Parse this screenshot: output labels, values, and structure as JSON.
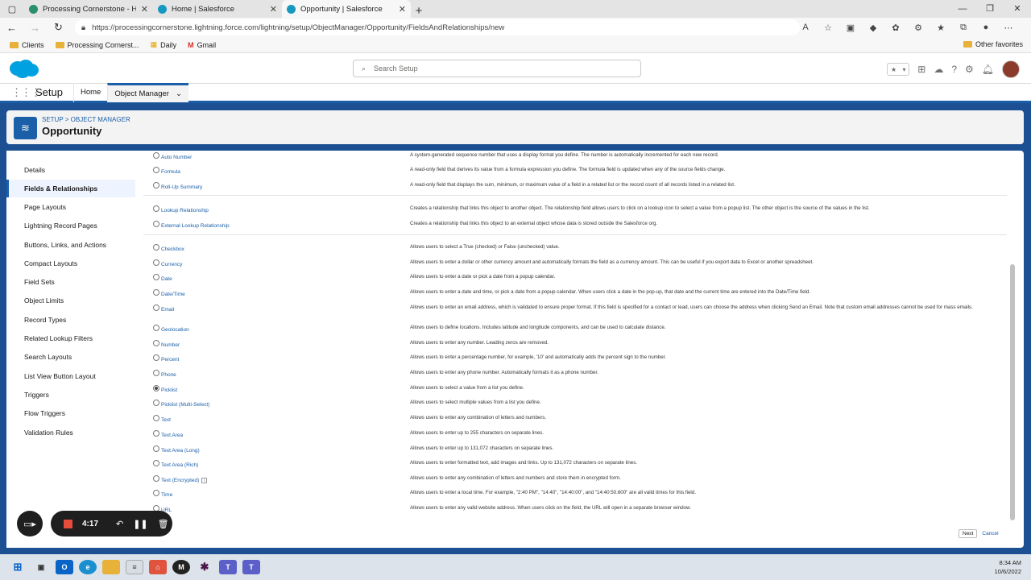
{
  "browser": {
    "tabs": [
      {
        "title": "Processing Cornerstone - Home",
        "favicon_color": "#2a8f6a"
      },
      {
        "title": "Home | Salesforce",
        "favicon_color": "#1798c1"
      },
      {
        "title": "Opportunity | Salesforce",
        "favicon_color": "#1798c1"
      }
    ],
    "url": "https://processingcornerstone.lightning.force.com/lightning/setup/ObjectManager/Opportunity/FieldsAndRelationships/new",
    "bookmarks": [
      "Clients",
      "Processing Cornerst...",
      "Daily",
      "Gmail"
    ],
    "other_favorites": "Other favorites"
  },
  "header": {
    "search_placeholder": "Search Setup"
  },
  "nav": {
    "app_name": "Setup",
    "home": "Home",
    "object_manager": "Object Manager"
  },
  "object": {
    "breadcrumb": "SETUP > OBJECT MANAGER",
    "title": "Opportunity"
  },
  "sidebar": {
    "items": [
      "Details",
      "Fields & Relationships",
      "Page Layouts",
      "Lightning Record Pages",
      "Buttons, Links, and Actions",
      "Compact Layouts",
      "Field Sets",
      "Object Limits",
      "Record Types",
      "Related Lookup Filters",
      "Search Layouts",
      "List View Button Layout",
      "Triggers",
      "Flow Triggers",
      "Validation Rules"
    ],
    "active_index": 1
  },
  "field_types": [
    {
      "label": "Auto Number",
      "desc": "A system-generated sequence number that uses a display format you define. The number is automatically incremented for each new record."
    },
    {
      "label": "Formula",
      "desc": "A read-only field that derives its value from a formula expression you define. The formula field is updated when any of the source fields change."
    },
    {
      "label": "Roll-Up Summary",
      "desc": "A read-only field that displays the sum, minimum, or maximum value of a field in a related list or the record count of all records listed in a related list."
    },
    {
      "label": "Lookup Relationship",
      "desc": "Creates a relationship that links this object to another object. The relationship field allows users to click on a lookup icon to select a value from a popup list. The other object is the source of the values in the list."
    },
    {
      "label": "External Lookup Relationship",
      "desc": "Creates a relationship that links this object to an external object whose data is stored outside the Salesforce org."
    },
    {
      "label": "Checkbox",
      "desc": "Allows users to select a True (checked) or False (unchecked) value."
    },
    {
      "label": "Currency",
      "desc": "Allows users to enter a dollar or other currency amount and automatically formats the field as a currency amount. This can be useful if you export data to Excel or another spreadsheet."
    },
    {
      "label": "Date",
      "desc": "Allows users to enter a date or pick a date from a popup calendar."
    },
    {
      "label": "Date/Time",
      "desc": "Allows users to enter a date and time, or pick a date from a popup calendar. When users click a date in the pop-up, that date and the current time are entered into the Date/Time field."
    },
    {
      "label": "Email",
      "desc": "Allows users to enter an email address, which is validated to ensure proper format. If this field is specified for a contact or lead, users can choose the address when clicking Send an Email. Note that custom email addresses cannot be used for mass emails."
    },
    {
      "label": "Geolocation",
      "desc": "Allows users to define locations. Includes latitude and longitude components, and can be used to calculate distance."
    },
    {
      "label": "Number",
      "desc": "Allows users to enter any number. Leading zeros are removed."
    },
    {
      "label": "Percent",
      "desc": "Allows users to enter a percentage number, for example, '10' and automatically adds the percent sign to the number."
    },
    {
      "label": "Phone",
      "desc": "Allows users to enter any phone number. Automatically formats it as a phone number."
    },
    {
      "label": "Picklist",
      "desc": "Allows users to select a value from a list you define."
    },
    {
      "label": "Picklist (Multi-Select)",
      "desc": "Allows users to select multiple values from a list you define."
    },
    {
      "label": "Text",
      "desc": "Allows users to enter any combination of letters and numbers."
    },
    {
      "label": "Text Area",
      "desc": "Allows users to enter up to 255 characters on separate lines."
    },
    {
      "label": "Text Area (Long)",
      "desc": "Allows users to enter up to 131,072 characters on separate lines."
    },
    {
      "label": "Text Area (Rich)",
      "desc": "Allows users to enter formatted text, add images and links. Up to 131,072 characters on separate lines."
    },
    {
      "label": "Text (Encrypted)",
      "desc": "Allows users to enter any combination of letters and numbers and store them in encrypted form."
    },
    {
      "label": "Time",
      "desc": "Allows users to enter a local time. For example, \"2:40 PM\", \"14:40\", \"14:40:00\", and \"14:40:50.600\" are all valid times for this field."
    },
    {
      "label": "URL",
      "desc": "Allows users to enter any valid website address. When users click on the field, the URL will open in a separate browser window."
    }
  ],
  "selected_field_type": "Picklist",
  "buttons": {
    "next": "Next",
    "cancel": "Cancel"
  },
  "recorder": {
    "time": "4:17"
  },
  "taskbar": {
    "time": "8:34 AM",
    "date": "10/6/2022"
  },
  "colors": {
    "brand": "#1b5fa8",
    "header_band": "#1d4f93"
  }
}
